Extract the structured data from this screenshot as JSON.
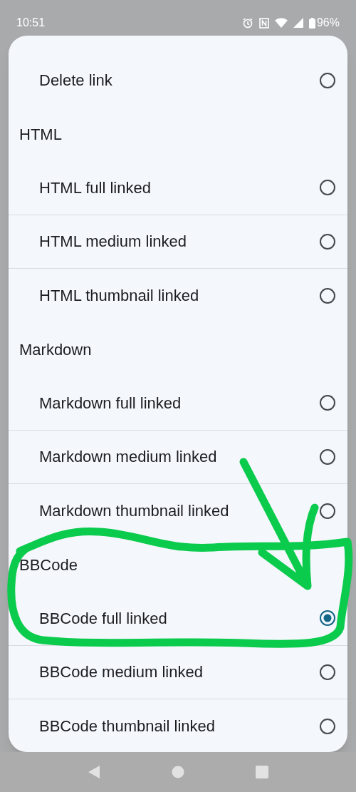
{
  "status_bar": {
    "time": "10:51",
    "battery": "96%"
  },
  "options": [
    {
      "kind": "option",
      "label": "Delete link",
      "selected": false
    },
    {
      "kind": "header",
      "label": "HTML"
    },
    {
      "kind": "option",
      "label": "HTML full linked",
      "selected": false
    },
    {
      "kind": "option",
      "label": "HTML medium linked",
      "selected": false
    },
    {
      "kind": "option",
      "label": "HTML thumbnail linked",
      "selected": false
    },
    {
      "kind": "header",
      "label": "Markdown"
    },
    {
      "kind": "option",
      "label": "Markdown full linked",
      "selected": false
    },
    {
      "kind": "option",
      "label": "Markdown medium linked",
      "selected": false
    },
    {
      "kind": "option",
      "label": "Markdown thumbnail linked",
      "selected": false
    },
    {
      "kind": "header",
      "label": "BBCode"
    },
    {
      "kind": "option",
      "label": "BBCode full linked",
      "selected": true
    },
    {
      "kind": "option",
      "label": "BBCode medium linked",
      "selected": false
    },
    {
      "kind": "option",
      "label": "BBCode thumbnail linked",
      "selected": false
    }
  ],
  "annotation": {
    "kind": "freehand"
  }
}
